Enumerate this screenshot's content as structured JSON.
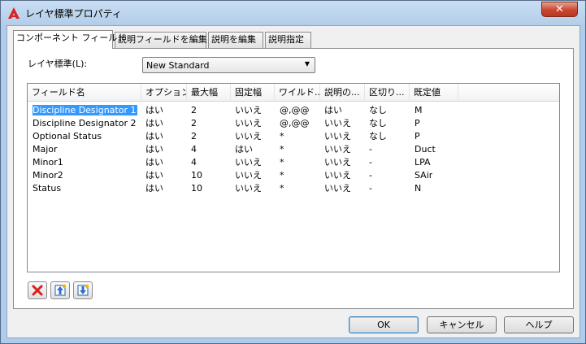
{
  "window": {
    "title": "レイヤ標準プロパティ",
    "close_glyph": "✕"
  },
  "tabs": [
    {
      "label": "コンポーネント フィールド",
      "active": true
    },
    {
      "label": "説明フィールドを編集",
      "active": false
    },
    {
      "label": "説明を編集",
      "active": false
    },
    {
      "label": "説明指定",
      "active": false
    }
  ],
  "layer_standard": {
    "label": "レイヤ標準(L):",
    "value": "New Standard"
  },
  "grid": {
    "columns": [
      "フィールド名",
      "オプション",
      "最大幅",
      "固定幅",
      "ワイルド...",
      "説明の...",
      "区切り...",
      "既定値"
    ],
    "rows": [
      [
        "Discipline Designator 1",
        "はい",
        "2",
        "いいえ",
        "@,@@",
        "はい",
        "なし",
        "M"
      ],
      [
        "Discipline Designator 2",
        "はい",
        "2",
        "いいえ",
        "@,@@",
        "いいえ",
        "なし",
        "P"
      ],
      [
        "Optional Status",
        "はい",
        "2",
        "いいえ",
        "*",
        "いいえ",
        "なし",
        "P"
      ],
      [
        "Major",
        "はい",
        "4",
        "はい",
        "*",
        "いいえ",
        "-",
        "Duct"
      ],
      [
        "Minor1",
        "はい",
        "4",
        "いいえ",
        "*",
        "いいえ",
        "-",
        "LPA"
      ],
      [
        "Minor2",
        "はい",
        "10",
        "いいえ",
        "*",
        "いいえ",
        "-",
        "SAir"
      ],
      [
        "Status",
        "はい",
        "10",
        "いいえ",
        "*",
        "いいえ",
        "-",
        "N"
      ]
    ],
    "selected_row": 0
  },
  "toolbar": {
    "icons": [
      "delete-icon",
      "move-up-icon",
      "move-down-icon"
    ]
  },
  "buttons": {
    "ok": "OK",
    "cancel": "キャンセル",
    "help": "ヘルプ"
  },
  "colors": {
    "selection": "#3399ff",
    "delete_red": "#d9201c",
    "titlebar": "#b9d1ea"
  }
}
